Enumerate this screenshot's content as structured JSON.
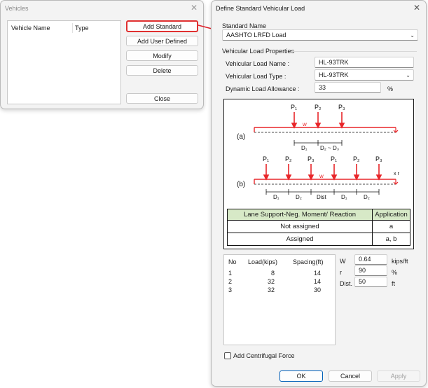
{
  "vehicles_window": {
    "title": "Vehicles",
    "columns": [
      "Vehicle Name",
      "Type"
    ],
    "buttons": {
      "add_standard": "Add Standard",
      "add_user_defined": "Add User Defined",
      "modify": "Modify",
      "delete": "Delete",
      "close": "Close"
    }
  },
  "define_window": {
    "title": "Define Standard Vehicular Load",
    "standard_name_label": "Standard Name",
    "standard_name_value": "AASHTO LRFD Load",
    "properties_label": "Vehicular Load Properties",
    "load_name_label": "Vehicular Load Name :",
    "load_name_value": "HL-93TRK",
    "load_type_label": "Vehicular Load Type :",
    "load_type_value": "HL-93TRK",
    "dynamic_label": "Dynamic Load Allowance :",
    "dynamic_value": "33",
    "dynamic_unit": "%",
    "diagram": {
      "a_label": "(a)",
      "b_label": "(b)",
      "p1": "P₁",
      "p2": "P₂",
      "p3": "P₃",
      "w": "w",
      "d1": "D₁",
      "d2": "D₂",
      "d2d3": "D₂ ~ D₃",
      "dist": "Dist",
      "xr": "x r",
      "table_headers": [
        "Lane Support-Neg. Moment/ Reaction",
        "Application"
      ],
      "table_rows": [
        [
          "Not assigned",
          "a"
        ],
        [
          "Assigned",
          "a, b"
        ]
      ]
    },
    "axle_table": {
      "headers": [
        "No",
        "Load(kips)",
        "Spacing(ft)"
      ],
      "rows": [
        [
          "1",
          "8",
          "14"
        ],
        [
          "2",
          "32",
          "14"
        ],
        [
          "3",
          "32",
          "30"
        ]
      ]
    },
    "w_label": "W",
    "w_value": "0.64",
    "w_unit": "kips/ft",
    "r_label": "r",
    "r_value": "90",
    "r_unit": "%",
    "dist_label": "Dist.",
    "dist_value": "50",
    "dist_unit": "ft",
    "centrifugal_label": "Add Centrifugal Force",
    "ok": "OK",
    "cancel": "Cancel",
    "apply": "Apply"
  },
  "colors": {
    "accent_red": "#e0202a",
    "highlight_box": "#e03030",
    "diagram_red": "#e8262a",
    "table_header_bg": "#d7e9c7"
  }
}
